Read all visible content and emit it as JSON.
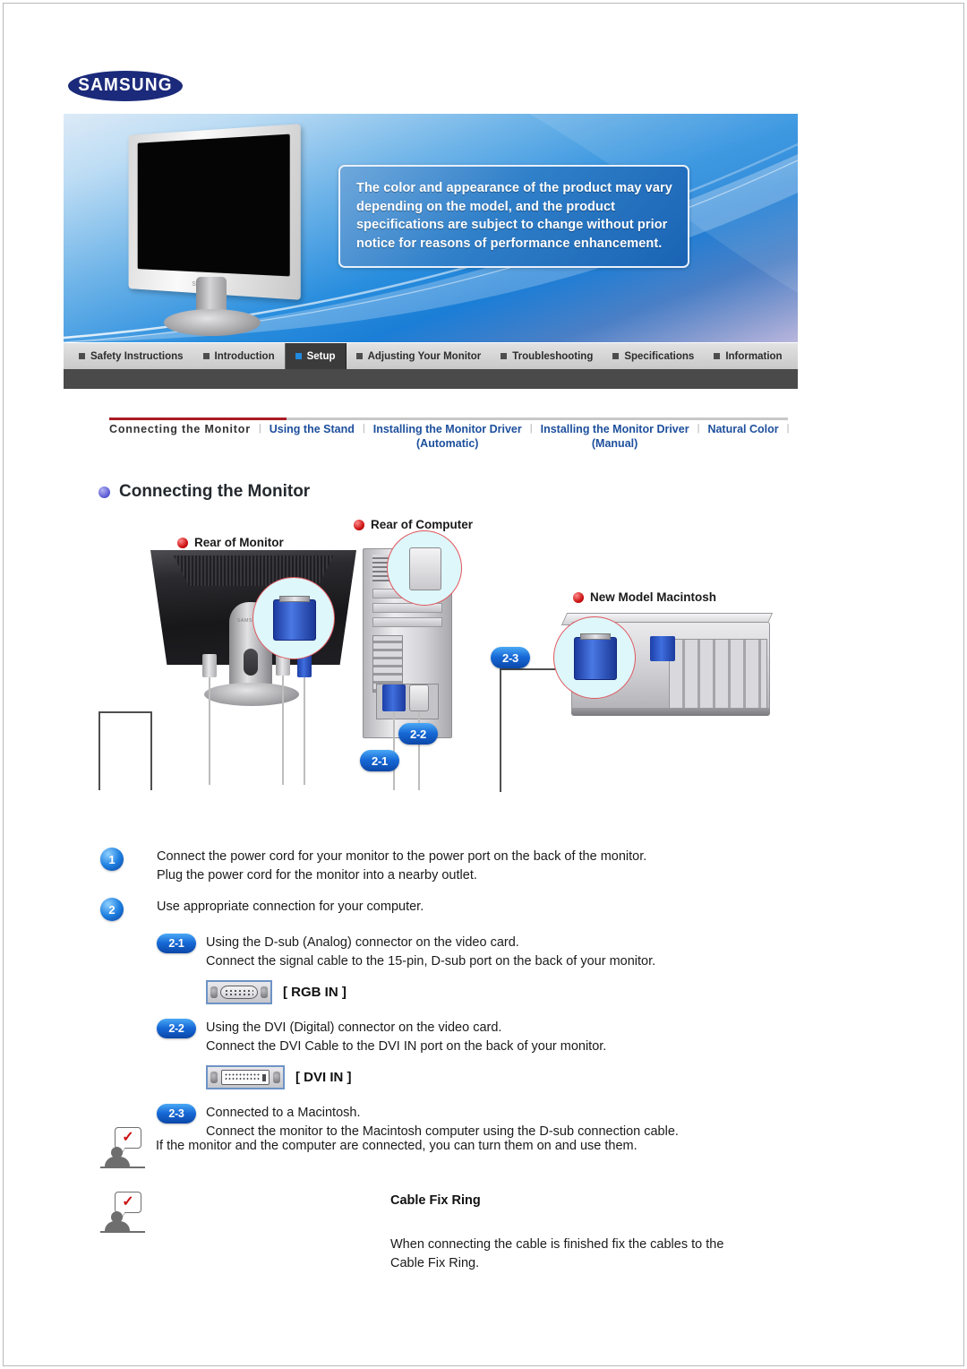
{
  "brand": {
    "logo_text": "SAMSUNG"
  },
  "banner": {
    "notice": "The color and appearance of the product may vary depending on the model, and the product specifications are subject to change without prior notice for reasons of performance enhancement.",
    "monitor_brand_label": "SAMSUNG"
  },
  "nav": {
    "items": [
      {
        "label": "Safety Instructions",
        "active": false
      },
      {
        "label": "Introduction",
        "active": false
      },
      {
        "label": "Setup",
        "active": true
      },
      {
        "label": "Adjusting Your Monitor",
        "active": false
      },
      {
        "label": "Troubleshooting",
        "active": false
      },
      {
        "label": "Specifications",
        "active": false
      },
      {
        "label": "Information",
        "active": false
      }
    ]
  },
  "subnav": {
    "separator": "|",
    "items": [
      {
        "label": "Connecting  the  Monitor",
        "sub": "",
        "current": true
      },
      {
        "label": "Using the Stand",
        "sub": "",
        "current": false
      },
      {
        "label": "Installing the Monitor Driver",
        "sub": "(Automatic)",
        "current": false
      },
      {
        "label": "Installing the Monitor Driver",
        "sub": "(Manual)",
        "current": false
      },
      {
        "label": "Natural Color",
        "sub": "",
        "current": false
      }
    ]
  },
  "section": {
    "title": "Connecting the Monitor"
  },
  "diagram": {
    "labels": {
      "monitor": "Rear of Monitor",
      "computer": "Rear of Computer",
      "macintosh": "New Model Macintosh"
    },
    "callouts": {
      "c21": "2-1",
      "c22": "2-2",
      "c23": "2-3"
    }
  },
  "steps": [
    {
      "number": "1",
      "line1": "Connect the power cord for your monitor to the power port on the back of the monitor.",
      "line2": "Plug the power cord for the monitor into a nearby outlet."
    },
    {
      "number": "2",
      "line1": "Use appropriate connection for your computer.",
      "line2": ""
    }
  ],
  "substeps": [
    {
      "badge": "2-1",
      "line1": "Using the D-sub (Analog) connector on the video card.",
      "line2": "Connect the signal cable to the 15-pin, D-sub port on the back of your monitor.",
      "port_label": "[ RGB IN ]",
      "port_icon": "vga-port-icon"
    },
    {
      "badge": "2-2",
      "line1": "Using the DVI (Digital) connector on the video card.",
      "line2": "Connect the DVI Cable to the DVI IN port on the back of your monitor.",
      "port_label": "[ DVI IN ]",
      "port_icon": "dvi-port-icon"
    },
    {
      "badge": "2-3",
      "line1": "Connected to a Macintosh.",
      "line2": "Connect the monitor to the Macintosh computer using the D-sub connection cable.",
      "port_label": "",
      "port_icon": ""
    }
  ],
  "notes": [
    {
      "text": "If the monitor and the computer are connected, you can turn them on and use them.",
      "heading": ""
    },
    {
      "heading": "Cable Fix Ring",
      "line1": "When connecting the cable is finished fix the cables to the",
      "line2": "Cable Fix Ring."
    }
  ],
  "colors": {
    "brand_navy": "#1b2a7a",
    "accent_blue": "#1668d6",
    "red_rule": "#a81c22",
    "nav_active_bg": "#3b3b3b",
    "link_blue": "#1d4f9c"
  }
}
